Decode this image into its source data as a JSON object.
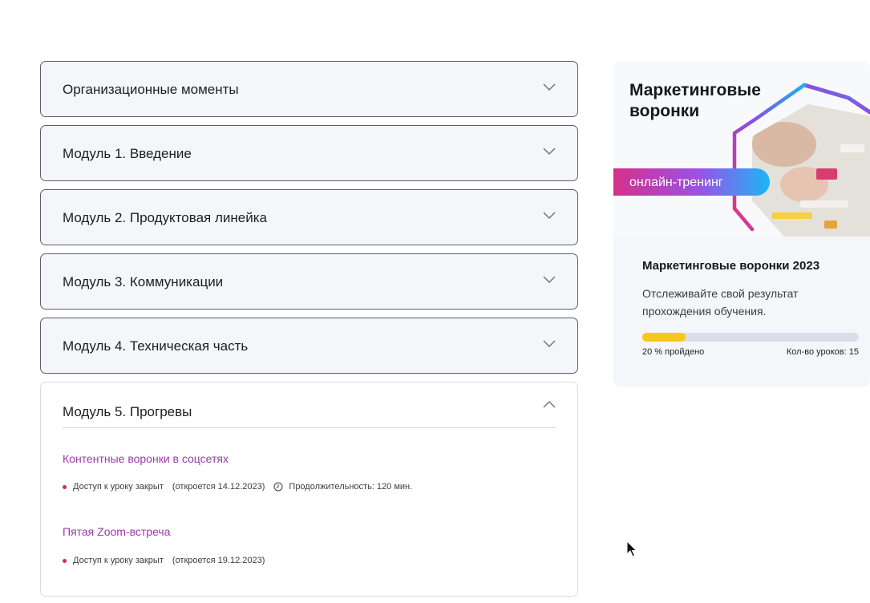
{
  "modules": [
    {
      "title": "Организационные моменты"
    },
    {
      "title": "Модуль 1. Введение"
    },
    {
      "title": "Модуль 2. Продуктовая линейка"
    },
    {
      "title": "Модуль 3. Коммуникации"
    },
    {
      "title": "Модуль 4. Техническая часть"
    }
  ],
  "open_module": {
    "title": "Модуль 5. Прогревы",
    "lessons": [
      {
        "title": "Контентные воронки в соцсетях",
        "status": "Доступ к уроку закрыт",
        "opens": "(откроется 14.12.2023)",
        "duration": "Продолжительность: 120 мин."
      },
      {
        "title": "Пятая Zoom-встреча",
        "status": "Доступ к уроку закрыт",
        "opens": "(откроется 19.12.2023)"
      }
    ]
  },
  "course_card": {
    "banner_title": "Маркетинговые воронки",
    "banner_badge": "онлайн-тренинг",
    "title": "Маркетинговые воронки 2023",
    "description": "Отслеживайте свой результат прохождения обучения.",
    "progress_percent": 20,
    "progress_label": "20 % пройдено",
    "lessons_count_label": "Кол-во уроков: 15"
  },
  "colors": {
    "accent_link": "#9a3aa8",
    "progress": "#f7c81c",
    "locked_dot": "#e0245e"
  },
  "icons": {
    "expand": "chevron-down-icon",
    "collapse": "chevron-up-icon",
    "duration": "clock-icon"
  }
}
